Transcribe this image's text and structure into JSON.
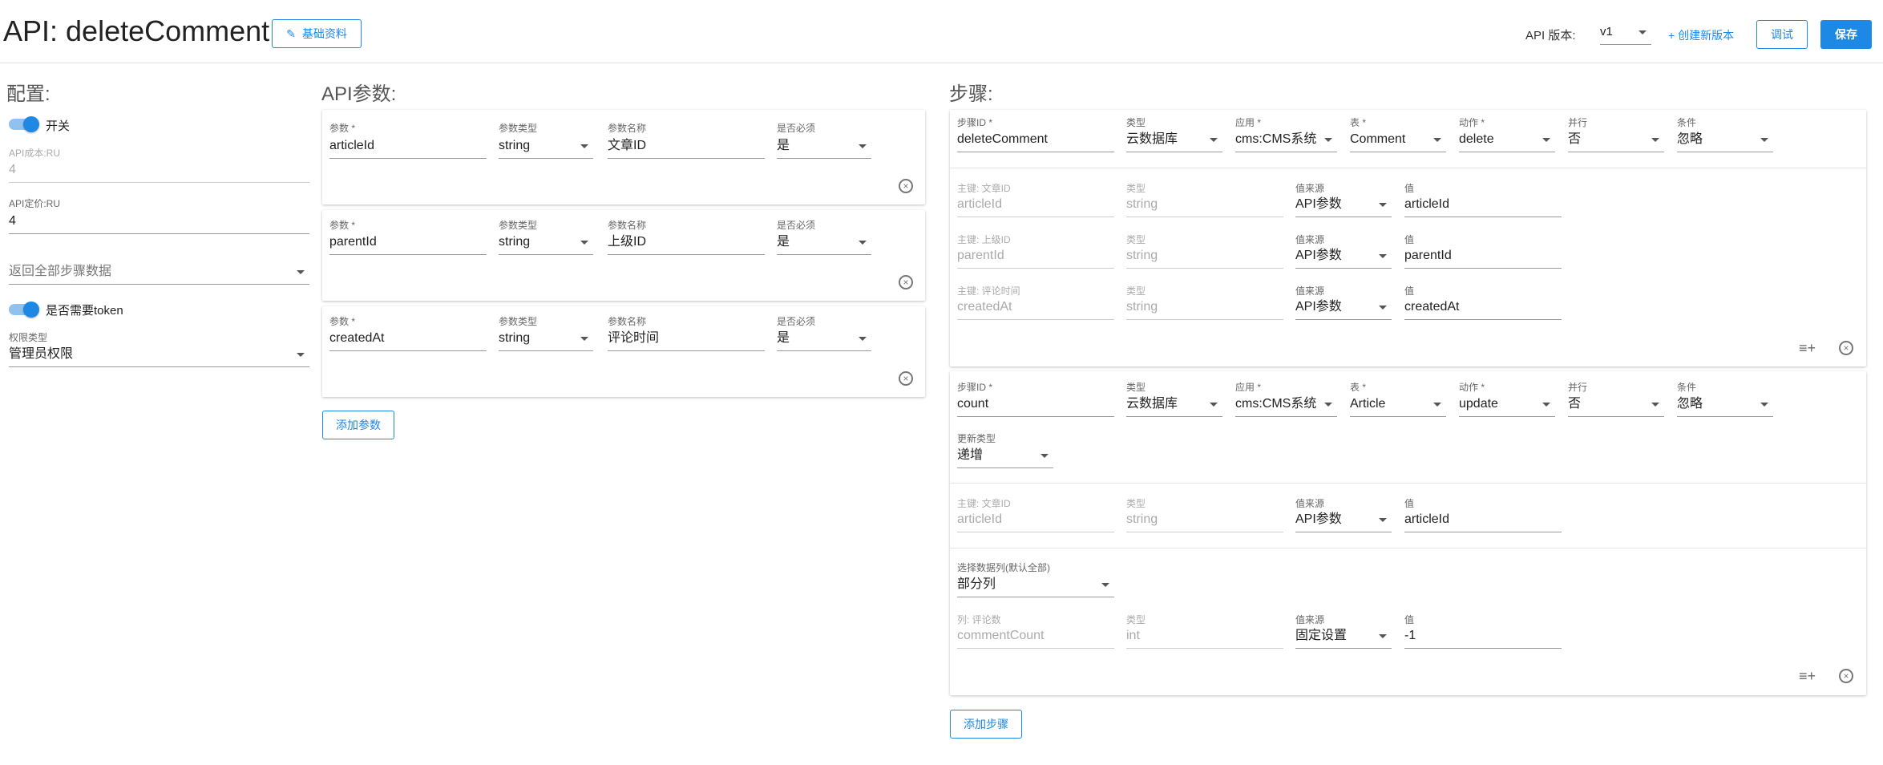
{
  "header": {
    "title": "API: deleteComment",
    "basic_info_btn": "基础资料",
    "version_label": "API 版本:",
    "version_value": "v1",
    "create_version": "+ 创建新版本",
    "debug_btn": "调试",
    "save_btn": "保存"
  },
  "config": {
    "title": "配置:",
    "switch_label": "开关",
    "cost_label": "API成本:RU",
    "cost_value": "4",
    "price_label": "API定价:RU",
    "price_value": "4",
    "return_all_placeholder": "返回全部步骤数据",
    "token_label": "是否需要token",
    "perm_label": "权限类型",
    "perm_value": "管理员权限"
  },
  "params": {
    "title": "API参数:",
    "col_param": "参数 *",
    "col_type": "参数类型",
    "col_name": "参数名称",
    "col_required": "是否必须",
    "rows": [
      {
        "param": "articleId",
        "type": "string",
        "name": "文章ID",
        "required": "是"
      },
      {
        "param": "parentId",
        "type": "string",
        "name": "上级ID",
        "required": "是"
      },
      {
        "param": "createdAt",
        "type": "string",
        "name": "评论时间",
        "required": "是"
      }
    ],
    "add_btn": "添加参数"
  },
  "steps": {
    "title": "步骤:",
    "hdr": {
      "id": "步骤ID *",
      "type": "类型",
      "app": "应用 *",
      "table": "表 *",
      "action": "动作 *",
      "parallel": "并行",
      "condition": "条件"
    },
    "key_type": "类型",
    "key_src": "值来源",
    "key_val": "值",
    "step1": {
      "id": "deleteComment",
      "type": "云数据库",
      "app": "cms:CMS系统",
      "table": "Comment",
      "action": "delete",
      "parallel": "否",
      "condition": "忽略",
      "keys": [
        {
          "label": "主键: 文章ID",
          "field": "articleId",
          "type": "string",
          "src": "API参数",
          "val": "articleId"
        },
        {
          "label": "主键: 上级ID",
          "field": "parentId",
          "type": "string",
          "src": "API参数",
          "val": "parentId"
        },
        {
          "label": "主键: 评论时间",
          "field": "createdAt",
          "type": "string",
          "src": "API参数",
          "val": "createdAt"
        }
      ]
    },
    "step2": {
      "id": "count",
      "type": "云数据库",
      "app": "cms:CMS系统",
      "table": "Article",
      "action": "update",
      "parallel": "否",
      "condition": "忽略",
      "update_type_label": "更新类型",
      "update_type_value": "递增",
      "keys": [
        {
          "label": "主键: 文章ID",
          "field": "articleId",
          "type": "string",
          "src": "API参数",
          "val": "articleId"
        }
      ],
      "cols_label": "选择数据列(默认全部)",
      "cols_value": "部分列",
      "col_row": {
        "label": "列: 评论数",
        "field": "commentCount",
        "type": "int",
        "src": "固定设置",
        "val": "-1"
      }
    },
    "add_btn": "添加步骤"
  },
  "icons": {
    "edit": "pencil-icon",
    "close": "circle-close-icon",
    "list_add": "list-add-icon",
    "dropdown": "caret-down-icon"
  },
  "colors": {
    "primary": "#1e88e5",
    "switch_track": "#90c2f0"
  }
}
